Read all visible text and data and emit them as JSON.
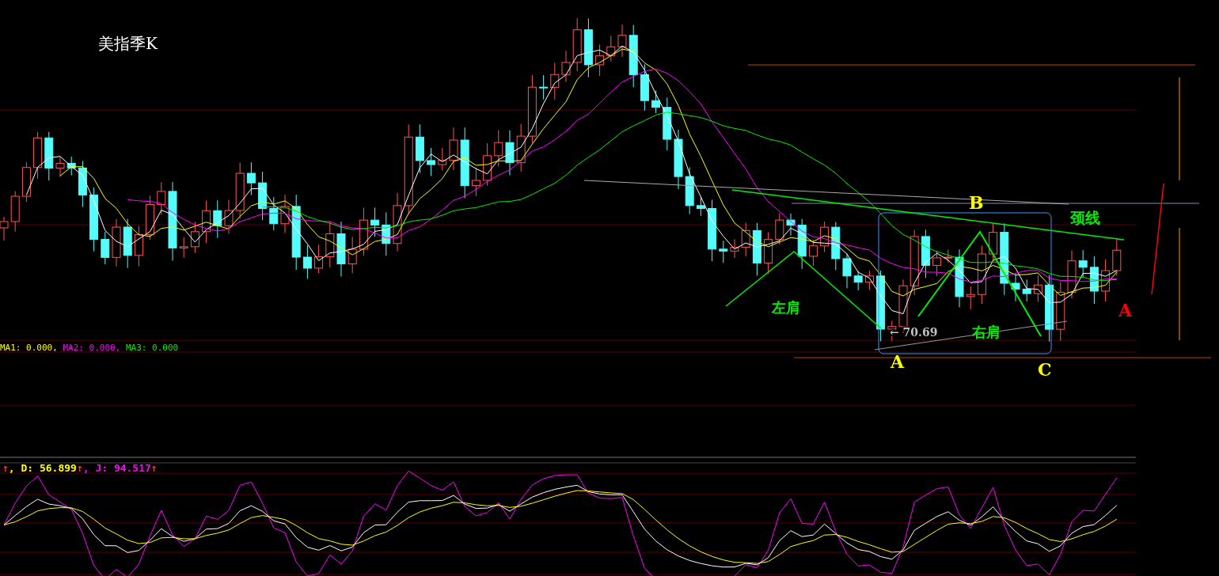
{
  "chart": {
    "title": "美指季K",
    "annotations": [
      {
        "text": "B",
        "color": "#ffff00"
      },
      {
        "text": "颈线",
        "color": "#00ee00"
      },
      {
        "text": "左肩",
        "color": "#00ee00"
      },
      {
        "text": "← 70.69",
        "color": "#c0c0c0"
      },
      {
        "text": "右肩",
        "color": "#00ee00"
      },
      {
        "text": "A",
        "color": "#ffff00"
      },
      {
        "text": "C",
        "color": "#ffff00"
      },
      {
        "text": "A",
        "color": "#ff0000"
      }
    ]
  },
  "ma_legend": [
    {
      "text": "MA1: 0.000, ",
      "color": "#ffff00"
    },
    {
      "text": "MA2: 0.000, ",
      "color": "#ff00ff"
    },
    {
      "text": "MA3: 0.000",
      "color": "#00ee00"
    }
  ],
  "kdj_legend": [
    {
      "text": "↑",
      "color": "#ff3333"
    },
    {
      "text": ", D: 56.899",
      "color": "#ffff00"
    },
    {
      "text": "↑",
      "color": "#ff3333"
    },
    {
      "text": ", J: 94.517",
      "color": "#ff00ff"
    },
    {
      "text": "↑",
      "color": "#ff3333"
    }
  ]
}
